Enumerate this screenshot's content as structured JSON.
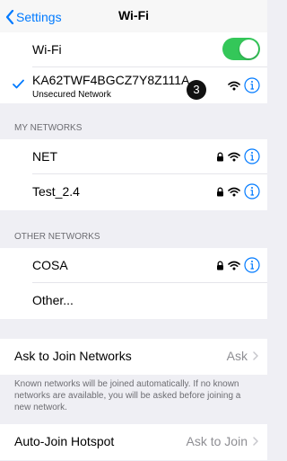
{
  "nav": {
    "back_label": "Settings",
    "title": "Wi-Fi"
  },
  "wifi_toggle": {
    "label": "Wi-Fi",
    "on": true
  },
  "current_network": {
    "name": "KA62TWF4BGCZ7Y8Z111A",
    "subtitle": "Unsecured Network",
    "badge": "3"
  },
  "my_networks": {
    "header": "MY NETWORKS",
    "items": [
      {
        "name": "NET"
      },
      {
        "name": "Test_2.4"
      }
    ]
  },
  "other_networks": {
    "header": "OTHER NETWORKS",
    "items": [
      {
        "name": "COSA"
      }
    ],
    "other_label": "Other..."
  },
  "ask_to_join": {
    "label": "Ask to Join Networks",
    "value": "Ask",
    "footnote": "Known networks will be joined automatically. If no known networks are available, you will be asked before joining a new network."
  },
  "auto_join": {
    "label": "Auto-Join Hotspot",
    "value": "Ask to Join"
  },
  "colors": {
    "accent": "#007aff",
    "toggle_on": "#34c759",
    "background": "#efeff4"
  }
}
